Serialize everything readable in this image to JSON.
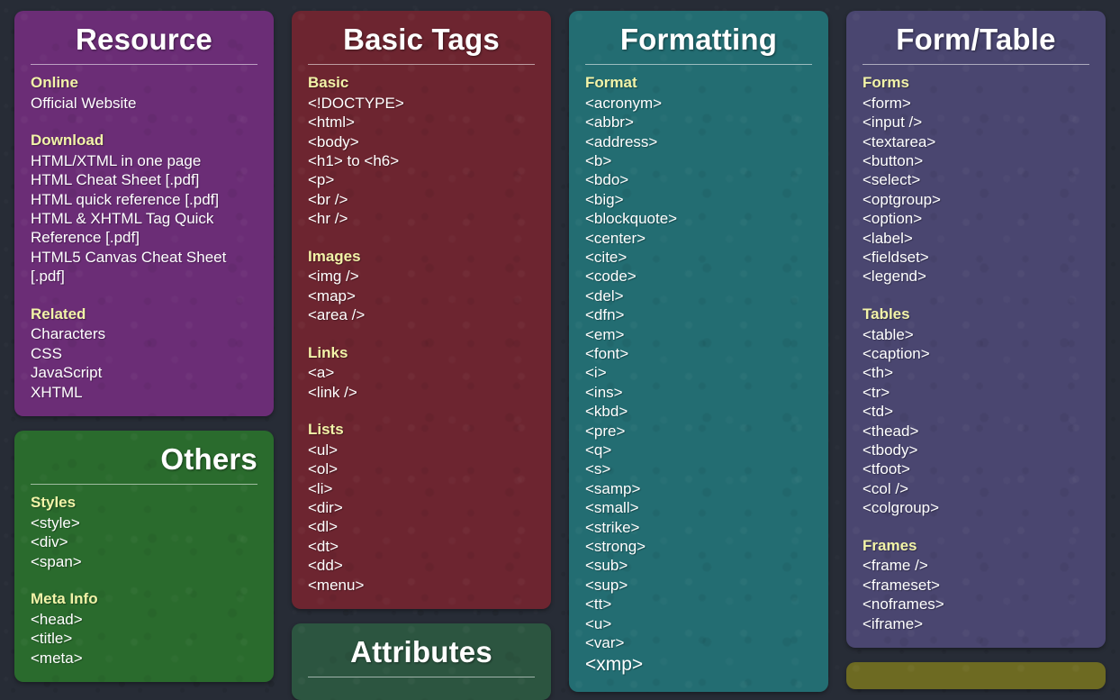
{
  "theme": {
    "background": "#272c36",
    "heading_color": "#f2f3a8",
    "text_color": "#ffffff",
    "colors": {
      "resource": "#6b2d76",
      "basic_tags": "#6d2530",
      "formatting": "#236d72",
      "form_table": "#4a4670",
      "others": "#2a6b2d",
      "attributes": "#2c5540",
      "bottom_right": "#6d6a22"
    }
  },
  "columns": [
    {
      "name": "column-1",
      "panels": [
        {
          "id": "resource",
          "title": "Resource",
          "title_align": "center",
          "theme": "theme-purple",
          "sections": [
            {
              "title": "Online",
              "items": [
                "Official Website"
              ]
            },
            {
              "title": "Download",
              "items": [
                "HTML/XTML in one page",
                "HTML Cheat Sheet [.pdf]",
                "HTML quick reference [.pdf]",
                "HTML & XHTML Tag Quick Reference [.pdf]",
                "HTML5 Canvas Cheat Sheet [.pdf]"
              ]
            },
            {
              "title": "Related",
              "items": [
                "Characters",
                "CSS",
                "JavaScript",
                "XHTML"
              ]
            }
          ]
        },
        {
          "id": "others",
          "title": "Others",
          "title_align": "right",
          "theme": "theme-green",
          "sections": [
            {
              "title": "Styles",
              "items": [
                "<style>",
                "<div>",
                "<span>"
              ]
            },
            {
              "title": "Meta Info",
              "items": [
                "<head>",
                "<title>",
                "<meta>"
              ]
            }
          ]
        }
      ]
    },
    {
      "name": "column-2",
      "panels": [
        {
          "id": "basic-tags",
          "title": "Basic Tags",
          "title_align": "center",
          "theme": "theme-maroon",
          "sections": [
            {
              "title": "Basic",
              "items": [
                "<!DOCTYPE>",
                "<html>",
                "<body>",
                "<h1> to <h6>",
                "<p>",
                "<br />",
                "<hr />"
              ]
            },
            {
              "title": "Images",
              "items": [
                "<img />",
                "<map>",
                "<area />"
              ]
            },
            {
              "title": "Links",
              "items": [
                "<a>",
                "<link />"
              ]
            },
            {
              "title": "Lists",
              "items": [
                "<ul>",
                "<ol>",
                "<li>",
                "<dir>",
                "<dl>",
                "<dt>",
                "<dd>",
                "<menu>"
              ]
            }
          ]
        },
        {
          "id": "attributes",
          "title": "Attributes",
          "title_align": "center",
          "theme": "theme-forest",
          "sections": []
        }
      ]
    },
    {
      "name": "column-3",
      "panels": [
        {
          "id": "formatting",
          "title": "Formatting",
          "title_align": "center",
          "theme": "theme-teal",
          "sections": [
            {
              "title": "Format",
              "items": [
                "<acronym>",
                "<abbr>",
                "<address>",
                "<b>",
                "<bdo>",
                "<big>",
                "<blockquote>",
                "<center>",
                "<cite>",
                "<code>",
                "<del>",
                "<dfn>",
                "<em>",
                "<font>",
                "<i>",
                "<ins>",
                "<kbd>",
                "<pre>",
                "<q>",
                "<s>",
                "<samp>",
                "<small>",
                "<strike>",
                "<strong>",
                "<sub>",
                "<sup>",
                "<tt>",
                "<u>",
                "<var>"
              ],
              "large_items": [
                "<xmp>"
              ]
            }
          ]
        }
      ]
    },
    {
      "name": "column-4",
      "panels": [
        {
          "id": "form-table",
          "title": "Form/Table",
          "title_align": "center",
          "theme": "theme-slate",
          "sections": [
            {
              "title": "Forms",
              "items": [
                "<form>",
                "<input />",
                "<textarea>",
                "<button>",
                "<select>",
                "<optgroup>",
                "<option>",
                "<label>",
                "<fieldset>",
                "<legend>"
              ]
            },
            {
              "title": "Tables",
              "items": [
                "<table>",
                "<caption>",
                "<th>",
                "<tr>",
                "<td>",
                "<thead>",
                "<tbody>",
                "<tfoot>",
                "<col />",
                "<colgroup>"
              ]
            },
            {
              "title": "Frames",
              "items": [
                "<frame />",
                "<frameset>",
                "<noframes>",
                "<iframe>"
              ]
            }
          ]
        },
        {
          "id": "bottom-right",
          "title": "",
          "title_align": "center",
          "theme": "theme-olive",
          "sections": []
        }
      ]
    }
  ]
}
